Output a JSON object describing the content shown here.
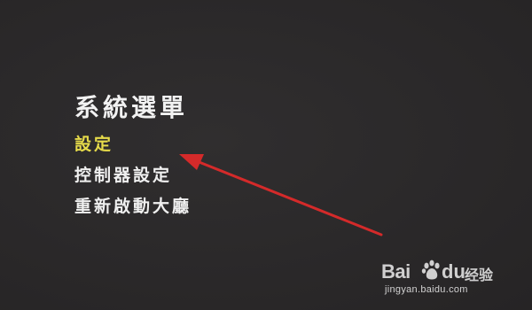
{
  "menu": {
    "title": "系統選單",
    "items": [
      {
        "label": "設定",
        "selected": true
      },
      {
        "label": "控制器設定",
        "selected": false
      },
      {
        "label": "重新啟動大廳",
        "selected": false
      }
    ]
  },
  "watermark": {
    "brand_left": "Bai",
    "brand_right": "du",
    "product": "经验",
    "url": "jingyan.baidu.com"
  },
  "colors": {
    "background": "#2a2829",
    "selected_item": "#e6db4a",
    "text": "#f0f0f0",
    "arrow": "#d42a2a"
  },
  "icons": [
    "baidu-paw-icon",
    "red-arrow-annotation"
  ]
}
